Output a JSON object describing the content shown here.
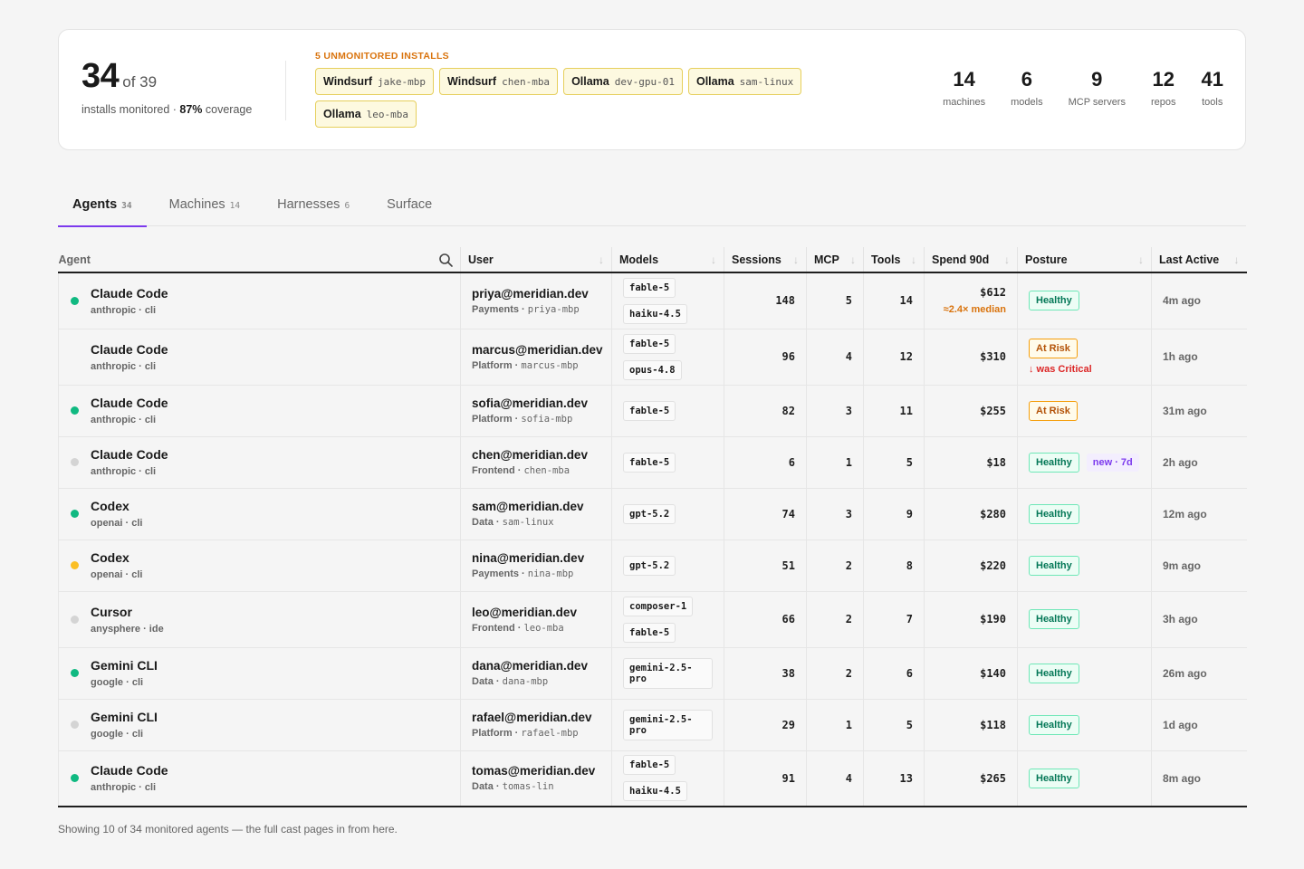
{
  "summary": {
    "monitored": "34",
    "of_total": "of 39",
    "sub_prefix": "installs monitored · ",
    "coverage": "87%",
    "sub_suffix": " coverage",
    "unmonitored_title": "5 UNMONITORED INSTALLS",
    "unmonitored": [
      {
        "tool": "Windsurf",
        "host": "jake-mbp"
      },
      {
        "tool": "Windsurf",
        "host": "chen-mba"
      },
      {
        "tool": "Ollama",
        "host": "dev-gpu-01"
      },
      {
        "tool": "Ollama",
        "host": "sam-linux"
      },
      {
        "tool": "Ollama",
        "host": "leo-mba"
      }
    ],
    "stats": [
      {
        "value": "14",
        "label": "machines"
      },
      {
        "value": "6",
        "label": "models"
      },
      {
        "value": "9",
        "label": "MCP servers"
      },
      {
        "value": "12",
        "label": "repos"
      },
      {
        "value": "41",
        "label": "tools"
      }
    ]
  },
  "tabs": [
    {
      "label": "Agents",
      "count": "34"
    },
    {
      "label": "Machines",
      "count": "14"
    },
    {
      "label": "Harnesses",
      "count": "6"
    },
    {
      "label": "Surface",
      "count": ""
    }
  ],
  "table": {
    "headers": [
      "Agent",
      "User",
      "Models",
      "Sessions",
      "MCP",
      "Tools",
      "Spend 90d",
      "Posture",
      "Last Active"
    ],
    "rows": [
      {
        "status": "green",
        "agent": "Claude Code",
        "vendor": "anthropic · cli",
        "email": "priya@meridian.dev",
        "team": "Payments",
        "host": "priya-mbp",
        "models": [
          "fable-5",
          "haiku-4.5"
        ],
        "sessions": "148",
        "mcp": "5",
        "tools": "14",
        "spend": "$612",
        "spend_note": "≈2.4× median",
        "posture": "Healthy",
        "posture_kind": "healthy",
        "posture_note": "",
        "tag": "",
        "last": "4m ago"
      },
      {
        "status": "none",
        "agent": "Claude Code",
        "vendor": "anthropic · cli",
        "email": "marcus@meridian.dev",
        "team": "Platform",
        "host": "marcus-mbp",
        "models": [
          "fable-5",
          "opus-4.8"
        ],
        "sessions": "96",
        "mcp": "4",
        "tools": "12",
        "spend": "$310",
        "spend_note": "",
        "posture": "At Risk",
        "posture_kind": "risk",
        "posture_note": "↓ was Critical",
        "tag": "",
        "last": "1h ago"
      },
      {
        "status": "green",
        "agent": "Claude Code",
        "vendor": "anthropic · cli",
        "email": "sofia@meridian.dev",
        "team": "Platform",
        "host": "sofia-mbp",
        "models": [
          "fable-5"
        ],
        "sessions": "82",
        "mcp": "3",
        "tools": "11",
        "spend": "$255",
        "spend_note": "",
        "posture": "At Risk",
        "posture_kind": "risk",
        "posture_note": "",
        "tag": "",
        "last": "31m ago"
      },
      {
        "status": "grey",
        "agent": "Claude Code",
        "vendor": "anthropic · cli",
        "email": "chen@meridian.dev",
        "team": "Frontend",
        "host": "chen-mba",
        "models": [
          "fable-5"
        ],
        "sessions": "6",
        "mcp": "1",
        "tools": "5",
        "spend": "$18",
        "spend_note": "",
        "posture": "Healthy",
        "posture_kind": "healthy",
        "posture_note": "",
        "tag": "new · 7d",
        "last": "2h ago"
      },
      {
        "status": "green",
        "agent": "Codex",
        "vendor": "openai · cli",
        "email": "sam@meridian.dev",
        "team": "Data",
        "host": "sam-linux",
        "models": [
          "gpt-5.2"
        ],
        "sessions": "74",
        "mcp": "3",
        "tools": "9",
        "spend": "$280",
        "spend_note": "",
        "posture": "Healthy",
        "posture_kind": "healthy",
        "posture_note": "",
        "tag": "",
        "last": "12m ago"
      },
      {
        "status": "amber",
        "agent": "Codex",
        "vendor": "openai · cli",
        "email": "nina@meridian.dev",
        "team": "Payments",
        "host": "nina-mbp",
        "models": [
          "gpt-5.2"
        ],
        "sessions": "51",
        "mcp": "2",
        "tools": "8",
        "spend": "$220",
        "spend_note": "",
        "posture": "Healthy",
        "posture_kind": "healthy",
        "posture_note": "",
        "tag": "",
        "last": "9m ago"
      },
      {
        "status": "grey",
        "agent": "Cursor",
        "vendor": "anysphere · ide",
        "email": "leo@meridian.dev",
        "team": "Frontend",
        "host": "leo-mba",
        "models": [
          "composer-1",
          "fable-5"
        ],
        "sessions": "66",
        "mcp": "2",
        "tools": "7",
        "spend": "$190",
        "spend_note": "",
        "posture": "Healthy",
        "posture_kind": "healthy",
        "posture_note": "",
        "tag": "",
        "last": "3h ago"
      },
      {
        "status": "green",
        "agent": "Gemini CLI",
        "vendor": "google · cli",
        "email": "dana@meridian.dev",
        "team": "Data",
        "host": "dana-mbp",
        "models": [
          "gemini-2.5-pro"
        ],
        "sessions": "38",
        "mcp": "2",
        "tools": "6",
        "spend": "$140",
        "spend_note": "",
        "posture": "Healthy",
        "posture_kind": "healthy",
        "posture_note": "",
        "tag": "",
        "last": "26m ago"
      },
      {
        "status": "grey",
        "agent": "Gemini CLI",
        "vendor": "google · cli",
        "email": "rafael@meridian.dev",
        "team": "Platform",
        "host": "rafael-mbp",
        "models": [
          "gemini-2.5-pro"
        ],
        "sessions": "29",
        "mcp": "1",
        "tools": "5",
        "spend": "$118",
        "spend_note": "",
        "posture": "Healthy",
        "posture_kind": "healthy",
        "posture_note": "",
        "tag": "",
        "last": "1d ago"
      },
      {
        "status": "green",
        "agent": "Claude Code",
        "vendor": "anthropic · cli",
        "email": "tomas@meridian.dev",
        "team": "Data",
        "host": "tomas-lin",
        "models": [
          "fable-5",
          "haiku-4.5"
        ],
        "sessions": "91",
        "mcp": "4",
        "tools": "13",
        "spend": "$265",
        "spend_note": "",
        "posture": "Healthy",
        "posture_kind": "healthy",
        "posture_note": "",
        "tag": "",
        "last": "8m ago"
      }
    ]
  },
  "footer": "Showing 10 of 34 monitored agents — the full cast pages in from here.",
  "colors": {
    "accent": "#7c3aed",
    "healthy": "#047857",
    "risk": "#b45309",
    "warning": "#d9730d"
  }
}
